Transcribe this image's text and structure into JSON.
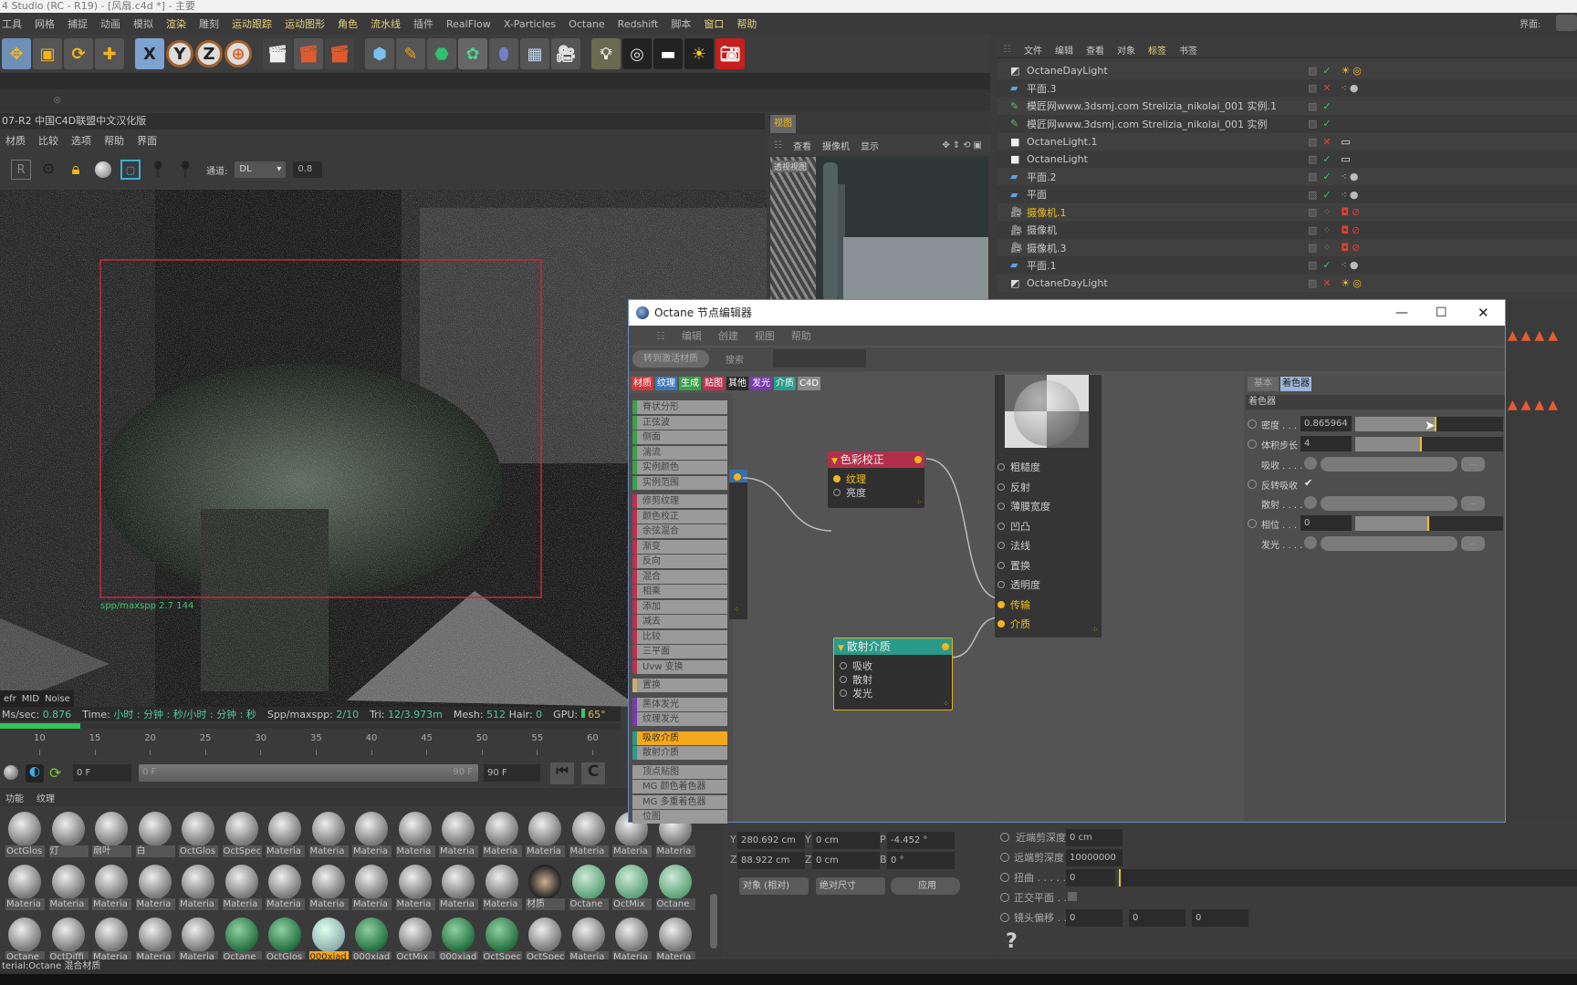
{
  "window_title": "4 Studio (RC - R19) - [风扇.c4d *] - 主要",
  "menu": [
    "工具",
    "网格",
    "捕捉",
    "动画",
    "模拟",
    "渲染",
    "雕刻",
    "运动跟踪",
    "运动图形",
    "角色",
    "流水线",
    "插件",
    "RealFlow",
    "X-Particles",
    "Octane",
    "Redshift",
    "脚本",
    "窗口",
    "帮助"
  ],
  "menu_highlight": [
    "渲染",
    "运动跟踪",
    "运动图形",
    "角色",
    "流水线",
    "窗口",
    "帮助"
  ],
  "layout_label": "界面:",
  "toolbar": {
    "icons": [
      "move-icon",
      "scale-icon",
      "rotate-icon",
      "add-icon",
      "x-axis-icon",
      "y-axis-icon",
      "z-axis-icon",
      "world-coord-icon",
      "render-view-icon",
      "render-picture-queue-icon",
      "render-settings-icon",
      "cube-icon",
      "pen-icon",
      "subdivision-icon",
      "cloner-icon",
      "deformer-icon",
      "floor-icon",
      "camera-icon",
      "light-icon",
      "octane-target-icon",
      "octane-area-light-icon",
      "octane-daylight-icon",
      "octane-camera-icon"
    ],
    "axis_labels": [
      "X",
      "Y",
      "Z"
    ]
  },
  "render_window": {
    "title": "07-R2 中国C4D联盟中文汉化版",
    "menu": [
      "材质",
      "比较",
      "选项",
      "帮助",
      "界面"
    ],
    "channel_label": "通道:",
    "channel_value": "DL",
    "value": "0.8",
    "overlay_text": "spp/maxspp 2.7 144",
    "bottom_tabs": [
      "efr",
      "MID",
      "Noise"
    ],
    "status": {
      "ms_label": "Ms/sec:",
      "ms_value": "0.876",
      "time_label": "Time:",
      "time_value": "小时 : 分钟 : 秒/小时 : 分钟 : 秒",
      "spp_label": "Spp/maxspp:",
      "spp_value": "2/10",
      "tri_label": "Tri:",
      "tri_value": "12/3.973m",
      "mesh_label": "Mesh:",
      "mesh_value": "512",
      "hair_label": "Hair:",
      "hair_value": "0",
      "gpu_label": "GPU:",
      "gpu_value": "65°"
    },
    "progress": 0.13
  },
  "timeline": {
    "ticks": [
      "10",
      "15",
      "20",
      "25",
      "30",
      "35",
      "40",
      "45",
      "50",
      "55",
      "60"
    ],
    "start_frame": "0 F",
    "range_start": "0 F",
    "range_end": "90 F",
    "end_frame": "90 F"
  },
  "material_tabs": [
    "功能",
    "纹理"
  ],
  "materials": [
    [
      "OctGlos",
      "灯",
      "扇叶",
      "白",
      "OctGlos",
      "OctSpec",
      "Materia",
      "Materia",
      "Materia",
      "Materia",
      "Materia",
      "Materia",
      "Materia",
      "Materia",
      "Materia",
      "Materia"
    ],
    [
      "Materia",
      "Materia",
      "Materia",
      "Materia",
      "Materia",
      "Materia",
      "Materia",
      "Materia",
      "Materia",
      "Materia",
      "Materia",
      "Materia",
      "材质",
      "Octane",
      "OctMix",
      "Octane"
    ],
    [
      "Octane",
      "OctDiffi",
      "Materia",
      "Materia",
      "Materia",
      "Octane",
      "OctGlos",
      "000xiad",
      "000xiad",
      "OctMix",
      "000xiad",
      "OctSpec",
      "OctSpec",
      "Materia",
      "Materia",
      "Materia"
    ]
  ],
  "selected_material": "000xiad",
  "status_bar": "terial:Octane 混合材质",
  "viewport": {
    "tab": "视图",
    "menu": [
      "查看",
      "摄像机",
      "显示"
    ],
    "camera_label": "透视视图"
  },
  "object_manager": {
    "menu": [
      "文件",
      "编辑",
      "查看",
      "对象",
      "标签",
      "书签"
    ],
    "objects": [
      {
        "name": "OctaneDayLight",
        "type": "daylight",
        "check": "ok"
      },
      {
        "name": "平面.3",
        "type": "plane",
        "check": "x"
      },
      {
        "name": "模匠网www.3dsmj.com  Strelizia_nikolai_001 实例.1",
        "type": "instance",
        "check": "ok"
      },
      {
        "name": "模匠网www.3dsmj.com  Strelizia_nikolai_001 实例",
        "type": "instance",
        "check": "ok"
      },
      {
        "name": "OctaneLight.1",
        "type": "light",
        "check": "x"
      },
      {
        "name": "OctaneLight",
        "type": "light",
        "check": "ok"
      },
      {
        "name": "平面.2",
        "type": "plane",
        "check": "ok"
      },
      {
        "name": "平面",
        "type": "plane",
        "check": "ok"
      },
      {
        "name": "摄像机.1",
        "type": "camera",
        "check": "dots",
        "active": true
      },
      {
        "name": "摄像机",
        "type": "camera",
        "check": "dots"
      },
      {
        "name": "摄像机.3",
        "type": "camera",
        "check": "dots"
      },
      {
        "name": "平面.1",
        "type": "plane",
        "check": "ok"
      },
      {
        "name": "OctaneDayLight",
        "type": "daylight",
        "check": "x"
      }
    ]
  },
  "node_editor": {
    "title": "Octane 节点编辑器",
    "menu": [
      "编辑",
      "创建",
      "视图",
      "帮助"
    ],
    "goto_button": "转到激活材质",
    "search_label": "搜索",
    "search_value": "",
    "categories": [
      {
        "label": "材质",
        "color": "#d0393c"
      },
      {
        "label": "纹理",
        "color": "#3a78b8"
      },
      {
        "label": "生成",
        "color": "#3aa04a"
      },
      {
        "label": "贴图",
        "color": "#c0304f"
      },
      {
        "label": "其他",
        "color": "#2a2a2a"
      },
      {
        "label": "发光",
        "color": "#7a3ab0"
      },
      {
        "label": "介质",
        "color": "#2a9a8a"
      },
      {
        "label": "C4D",
        "color": "#8a8a8a"
      }
    ],
    "node_list": [
      {
        "label": "脊状分形",
        "color": "#3aa04a"
      },
      {
        "label": "正弦波",
        "color": "#3aa04a"
      },
      {
        "label": "侧面",
        "color": "#3aa04a"
      },
      {
        "label": "湍流",
        "color": "#3aa04a"
      },
      {
        "label": "实例颜色",
        "color": "#3aa04a"
      },
      {
        "label": "实例范围",
        "color": "#3aa04a"
      },
      {
        "label": "修剪纹理",
        "color": "#c0304f"
      },
      {
        "label": "颜色校正",
        "color": "#c0304f"
      },
      {
        "label": "余弦混合",
        "color": "#c0304f"
      },
      {
        "label": "渐变",
        "color": "#c0304f"
      },
      {
        "label": "反向",
        "color": "#c0304f"
      },
      {
        "label": "混合",
        "color": "#c0304f"
      },
      {
        "label": "相乘",
        "color": "#c0304f"
      },
      {
        "label": "添加",
        "color": "#c0304f"
      },
      {
        "label": "减去",
        "color": "#c0304f"
      },
      {
        "label": "比较",
        "color": "#c0304f"
      },
      {
        "label": "三平面",
        "color": "#c0304f"
      },
      {
        "label": "Uvw 变换",
        "color": "#c0304f"
      },
      {
        "label": "置换",
        "color": "#c8b070"
      },
      {
        "label": "黑体发光",
        "color": "#7a3ab0"
      },
      {
        "label": "纹理发光",
        "color": "#7a3ab0"
      },
      {
        "label": "吸收介质",
        "color": "#2a9a8a",
        "selected": true
      },
      {
        "label": "散射介质",
        "color": "#2a9a8a"
      },
      {
        "label": "顶点贴图",
        "color": "#9a9a9a"
      },
      {
        "label": "MG 颜色着色器",
        "color": "#9a9a9a"
      },
      {
        "label": "MG 多重着色器",
        "color": "#9a9a9a"
      },
      {
        "label": "位图",
        "color": "#9a9a9a"
      }
    ],
    "color_correction_node": {
      "title": "色彩校正",
      "ports": [
        "纹理",
        "亮度"
      ],
      "active_port": "纹理",
      "color": "#b0304a"
    },
    "scatter_node": {
      "title": "散射介质",
      "ports": [
        "吸收",
        "散射",
        "发光"
      ],
      "color": "#2a9a8a"
    },
    "material_node": {
      "ports": [
        "粗糙度",
        "反射",
        "薄膜宽度",
        "凹凸",
        "法线",
        "置换",
        "透明度",
        "传输",
        "介质"
      ],
      "active_ports": [
        "传输",
        "介质"
      ]
    },
    "properties": {
      "tabs": [
        "基本",
        "着色器"
      ],
      "active_tab": "着色器",
      "section": "着色器",
      "density_label": "密度 . . .",
      "density_value": "0.865964",
      "density_level": 0.55,
      "step_label": "体积步长",
      "step_value": "4",
      "step_level": 0.45,
      "absorb_label": "吸收 . . . .",
      "invert_label": "反转吸收",
      "invert_checked": "✔",
      "scatter_label": "散射 . . . .",
      "phase_label": "相位 . . .",
      "phase_value": "0",
      "phase_level": 0.5,
      "emission_label": "发光 . . . .",
      "more_label": "..."
    }
  },
  "coordinates": {
    "rows": [
      {
        "a": "Y",
        "av": "280.692 cm",
        "b": "Y",
        "bv": "0 cm",
        "c": "P",
        "cv": "-4.452 °"
      },
      {
        "a": "Z",
        "av": "88.922 cm",
        "b": "Z",
        "bv": "0 cm",
        "c": "B",
        "cv": "0 °"
      }
    ],
    "mode": "对象 (相对)",
    "size_mode": "绝对尺寸",
    "apply": "应用"
  },
  "camera_attrs": {
    "near_label": "近端剪深度",
    "near_value": "0 cm",
    "far_label": "远端剪深度",
    "far_value": "10000000",
    "distort_label": "扭曲 . . . . .",
    "distort_value": "0",
    "ortho_label": "正交平面 . .",
    "offset_label": "镜头偏移 . .",
    "offset_values": [
      "0",
      "0",
      "0"
    ],
    "help": "?"
  },
  "colors": {
    "accent": "#f4a81d",
    "connected": "#f4b41a",
    "node_cc": "#b0304a",
    "node_scatter": "#2a9a8a"
  }
}
